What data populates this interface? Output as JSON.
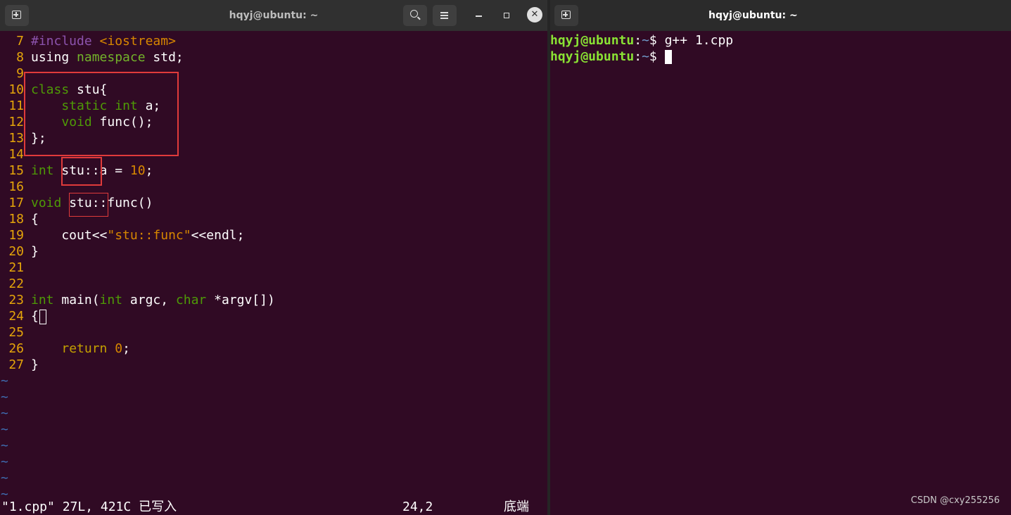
{
  "left_window": {
    "title": "hqyj@ubuntu: ~",
    "icons": {
      "new_tab": "new-tab-icon",
      "search": "search-icon",
      "menu": "hamburger-menu-icon",
      "minimize": "minimize-icon",
      "maximize": "maximize-icon",
      "close": "close-icon"
    },
    "close_glyph": "✕"
  },
  "editor": {
    "lines": [
      {
        "num": "7",
        "parts": [
          {
            "t": "#include ",
            "c": "kw-pre"
          },
          {
            "t": "<iostream>",
            "c": "str"
          }
        ]
      },
      {
        "num": "8",
        "parts": [
          {
            "t": "using ",
            "c": ""
          },
          {
            "t": "namespace",
            "c": "kw-green"
          },
          {
            "t": " std;",
            "c": ""
          }
        ]
      },
      {
        "num": "9",
        "parts": []
      },
      {
        "num": "10",
        "parts": [
          {
            "t": "class",
            "c": "kw-type"
          },
          {
            "t": " stu{",
            "c": ""
          }
        ]
      },
      {
        "num": "11",
        "parts": [
          {
            "t": "    ",
            "c": ""
          },
          {
            "t": "static",
            "c": "kw-type"
          },
          {
            "t": " ",
            "c": ""
          },
          {
            "t": "int",
            "c": "kw-type"
          },
          {
            "t": " a;",
            "c": ""
          }
        ]
      },
      {
        "num": "12",
        "parts": [
          {
            "t": "    ",
            "c": ""
          },
          {
            "t": "void",
            "c": "kw-type"
          },
          {
            "t": " func();",
            "c": ""
          }
        ]
      },
      {
        "num": "13",
        "parts": [
          {
            "t": "};",
            "c": ""
          }
        ]
      },
      {
        "num": "14",
        "parts": []
      },
      {
        "num": "15",
        "parts": [
          {
            "t": "int",
            "c": "kw-type"
          },
          {
            "t": " stu::a = ",
            "c": ""
          },
          {
            "t": "10",
            "c": "num"
          },
          {
            "t": ";",
            "c": ""
          }
        ]
      },
      {
        "num": "16",
        "parts": []
      },
      {
        "num": "17",
        "parts": [
          {
            "t": "void",
            "c": "kw-type"
          },
          {
            "t": " stu::func()",
            "c": ""
          }
        ]
      },
      {
        "num": "18",
        "parts": [
          {
            "t": "{",
            "c": ""
          }
        ]
      },
      {
        "num": "19",
        "parts": [
          {
            "t": "    cout<<",
            "c": ""
          },
          {
            "t": "\"stu::func\"",
            "c": "str"
          },
          {
            "t": "<<endl;",
            "c": ""
          }
        ]
      },
      {
        "num": "20",
        "parts": [
          {
            "t": "}",
            "c": ""
          }
        ]
      },
      {
        "num": "21",
        "parts": []
      },
      {
        "num": "22",
        "parts": []
      },
      {
        "num": "23",
        "parts": [
          {
            "t": "int",
            "c": "kw-type"
          },
          {
            "t": " main(",
            "c": ""
          },
          {
            "t": "int",
            "c": "kw-type"
          },
          {
            "t": " argc, ",
            "c": ""
          },
          {
            "t": "char",
            "c": "kw-type"
          },
          {
            "t": " *argv[])",
            "c": ""
          }
        ]
      },
      {
        "num": "24",
        "parts": [
          {
            "t": "{",
            "c": ""
          }
        ],
        "cursor": true
      },
      {
        "num": "25",
        "parts": []
      },
      {
        "num": "26",
        "parts": [
          {
            "t": "    ",
            "c": ""
          },
          {
            "t": "return",
            "c": "kw-stmt"
          },
          {
            "t": " ",
            "c": ""
          },
          {
            "t": "0",
            "c": "num"
          },
          {
            "t": ";",
            "c": ""
          }
        ]
      },
      {
        "num": "27",
        "parts": [
          {
            "t": "}",
            "c": ""
          }
        ]
      }
    ],
    "tilde": "~",
    "tilde_count": 8
  },
  "status_bar": {
    "file_info": "\"1.cpp\" 27L, 421C 已写入",
    "position": "24,2",
    "scroll": "底端"
  },
  "right_window": {
    "title": "hqyj@ubuntu: ~",
    "icons": {
      "new_tab": "new-tab-icon"
    }
  },
  "terminal": {
    "user_host": "hqyj@ubuntu",
    "sep": ":",
    "path": "~",
    "dollar": "$ ",
    "command1": "g++ 1.cpp",
    "command2": ""
  },
  "watermark": "CSDN @cxy255256",
  "colors": {
    "terminal_bg": "#300a24",
    "line_number": "#e5a50a",
    "type_keyword": "#4e9a06",
    "string_literal": "#d78700",
    "prompt_user": "#8ae234",
    "prompt_path": "#729fcf",
    "highlight_box": "#e03b3b"
  }
}
